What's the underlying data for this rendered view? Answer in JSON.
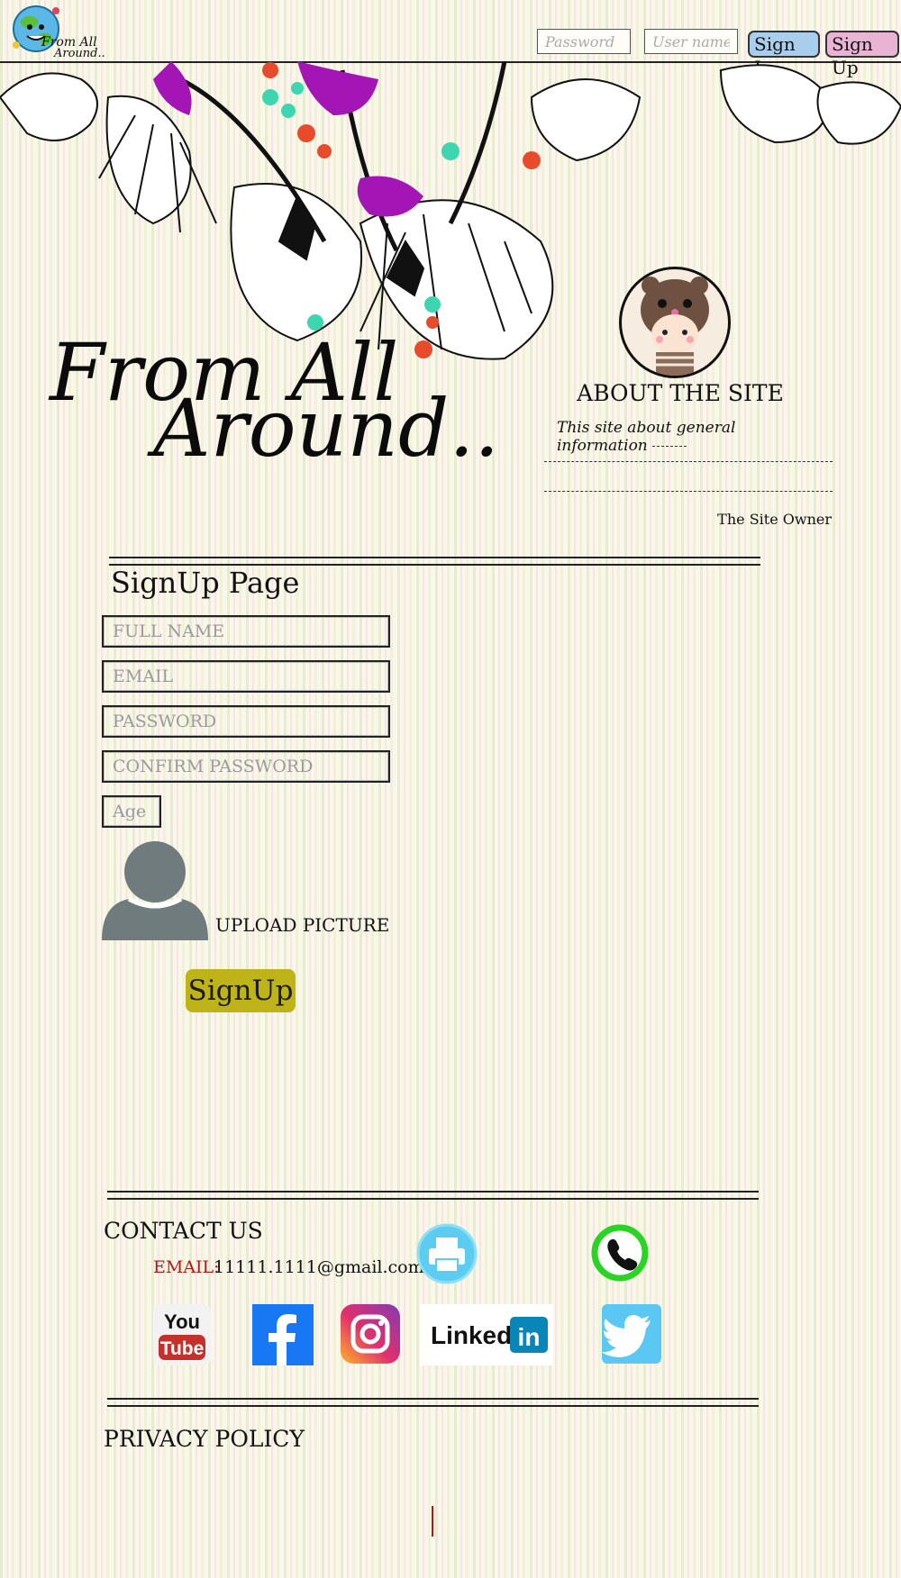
{
  "header": {
    "logo_line1": "From All",
    "logo_line2": "Around..",
    "password_placeholder": "Password",
    "username_placeholder": "User name",
    "signin_label": "Sign In",
    "signup_label": "Sign Up"
  },
  "hero": {
    "title_line1": "From All",
    "title_line2": "Around.."
  },
  "about": {
    "title": "ABOUT THE SITE",
    "text": "This site about general information",
    "owner": "The Site Owner"
  },
  "signup": {
    "title": "SignUp Page",
    "fields": {
      "full_name": "FULL NAME",
      "email": "EMAIL",
      "password": "PASSWORD",
      "confirm_password": "CONFIRM PASSWORD",
      "age": "Age"
    },
    "upload_label": "UPLOAD PICTURE",
    "submit_label": "SignUp"
  },
  "contact": {
    "title": "CONTACT US",
    "email_label": "EMAIL:",
    "email_value": "11111.1111@gmail.com",
    "linkedin_text": "Linked",
    "linkedin_in": "in",
    "youtube_you": "You",
    "youtube_tube": "Tube"
  },
  "privacy": {
    "title": "PRIVACY POLICY"
  },
  "colors": {
    "signin_bg": "#a9cdec",
    "signup_bg": "#e9b3d3",
    "signup_button": "#bfb31a",
    "email_label": "#b01818",
    "printer": "#5ccdf0",
    "phone": "#2bd324",
    "facebook": "#1877f2",
    "twitter": "#5bc8f3",
    "linkedin": "#0a85b7",
    "youtube": "#c4302b"
  }
}
